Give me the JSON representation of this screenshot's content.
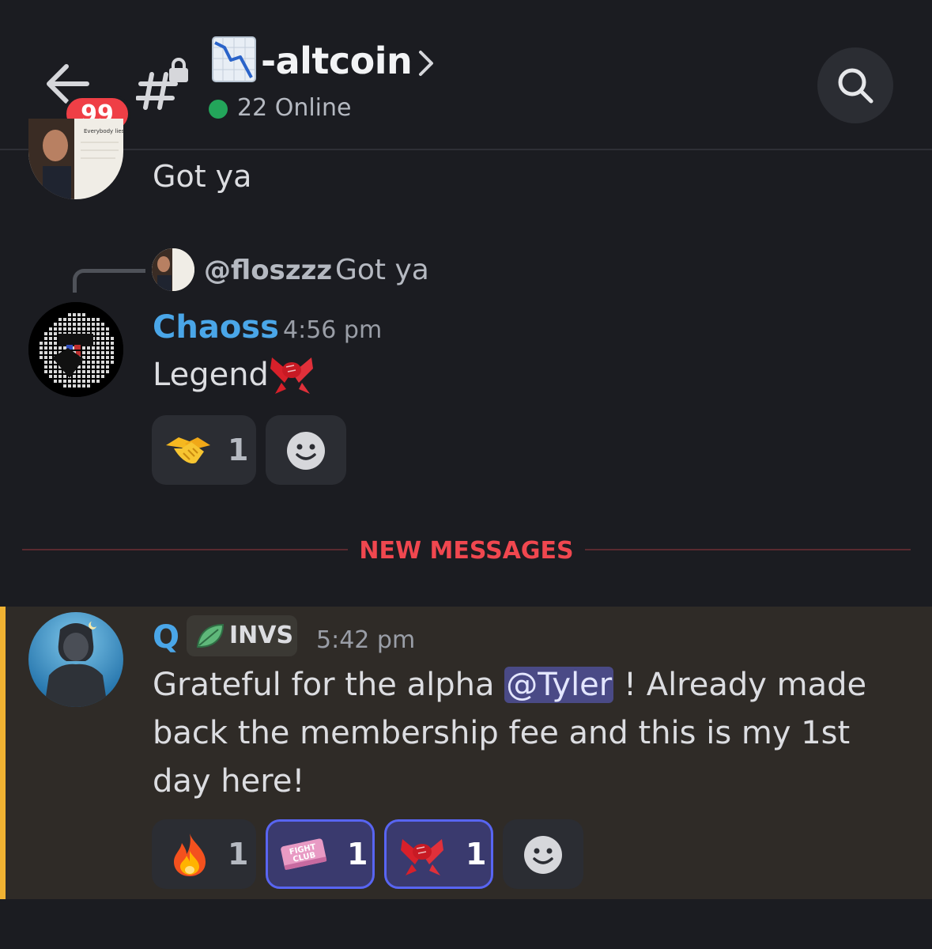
{
  "header": {
    "unread_badge": "99",
    "channel_name": "-altcoin",
    "online_text": "22 Online",
    "icons": [
      "back-arrow-icon",
      "locked-hash-icon",
      "chart-decreasing-emoji",
      "chevron-right-icon",
      "search-icon"
    ]
  },
  "messages": [
    {
      "text": "Got ya"
    },
    {
      "reply": {
        "user": "@floszzz",
        "text": "Got ya"
      },
      "author": "Chaoss",
      "time": "4:56 pm",
      "text": "Legend",
      "emoji": "handshake-fist-emoji",
      "reactions": [
        {
          "emoji": "handshake-emoji",
          "count": "1"
        }
      ]
    },
    {
      "author": "Q",
      "tag": "INVS",
      "time": "5:42 pm",
      "text_before": "Grateful for the alpha ",
      "mention": "@Tyler",
      "text_after": " ! Already made back the membership fee and this is my 1st day here!",
      "reactions": [
        {
          "emoji": "fire-emoji",
          "count": "1"
        },
        {
          "emoji": "fight-club-emoji",
          "count": "1"
        },
        {
          "emoji": "handshake-fist-emoji",
          "count": "1"
        }
      ]
    }
  ],
  "divider": {
    "label": "NEW MESSAGES"
  },
  "colors": {
    "background": "#1b1c21",
    "username": "#4aa6e8",
    "new_messages": "#f0474f",
    "highlight_bar": "#f0b232",
    "online": "#23a55a",
    "badge": "#ef3f46"
  }
}
